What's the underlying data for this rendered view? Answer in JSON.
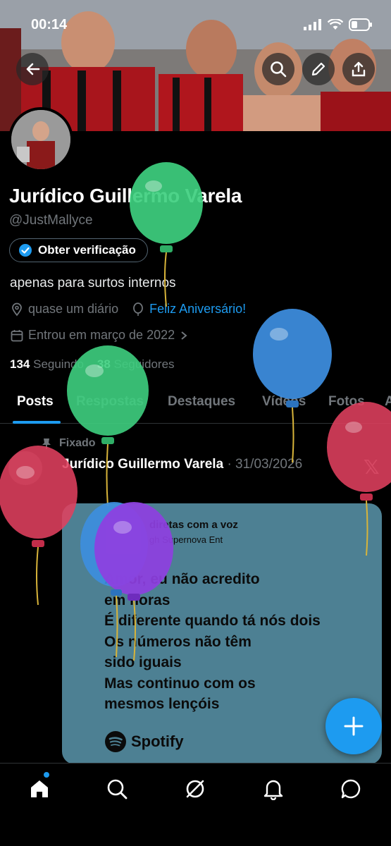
{
  "status_bar": {
    "time": "00:14"
  },
  "profile": {
    "name": "Jurídico Guillermo Varela",
    "handle": "@JustMallyce",
    "verify_label": "Obter verificação",
    "bio": "apenas para surtos internos",
    "location": "quase um diário",
    "birthday_link": "Feliz Aniversário!",
    "joined": "Entrou em março de 2022",
    "following_count": "134",
    "following_label": "Seguindo",
    "followers_count": "38",
    "followers_label": "Seguidores"
  },
  "tabs": [
    {
      "label": "Posts",
      "active": true
    },
    {
      "label": "Respostas"
    },
    {
      "label": "Destaques"
    },
    {
      "label": "Vídeos"
    },
    {
      "label": "Fotos"
    },
    {
      "label": "A"
    }
  ],
  "post": {
    "pinned_label": "Fixado",
    "author": "Jurídico Guillermo Varela",
    "date": "· 31/03/2026",
    "x_mark": "𝕏",
    "card": {
      "song": "diretas com a voz",
      "artist": "gh Supernova Ent",
      "lyrics": [
        "Amor, eu não acredito",
        "em horas",
        "É diferente quando tá nós dois",
        "Os números não têm",
        "sido iguais",
        "Mas continuo com os",
        "mesmos lençóis"
      ],
      "brand": "Spotify"
    }
  },
  "icons": {
    "back": "back-arrow-icon",
    "search": "search-icon",
    "edit": "pencil-icon",
    "share": "share-icon",
    "compose": "plus-icon"
  },
  "colors": {
    "accent": "#1d9bf0",
    "muted": "#71767b",
    "card_bg": "#4d8093",
    "balloon_green": "#3ecf7f",
    "balloon_blue": "#3d8ee0",
    "balloon_red": "#e0405e",
    "balloon_purple": "#8e3fe0"
  }
}
